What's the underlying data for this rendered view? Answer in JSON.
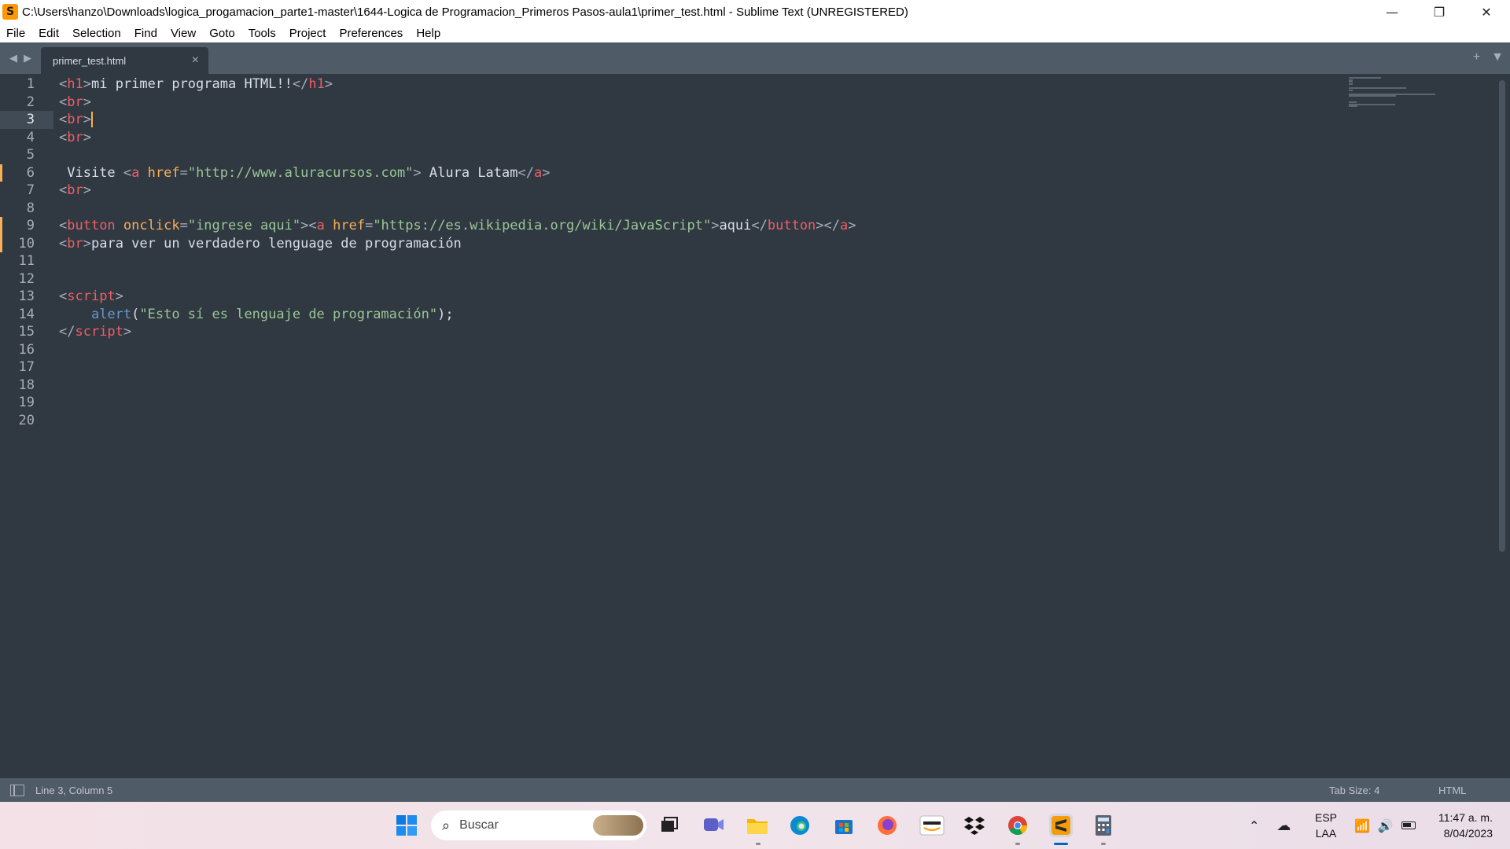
{
  "window": {
    "title": "C:\\Users\\hanzo\\Downloads\\logica_progamacion_parte1-master\\1644-Logica de Programacion_Primeros Pasos-aula1\\primer_test.html - Sublime Text (UNREGISTERED)",
    "app_icon": "sublime-text-icon",
    "controls": {
      "minimize": "—",
      "restore": "❐",
      "close": "✕"
    }
  },
  "menu": [
    "File",
    "Edit",
    "Selection",
    "Find",
    "View",
    "Goto",
    "Tools",
    "Project",
    "Preferences",
    "Help"
  ],
  "tabs": [
    {
      "label": "primer_test.html",
      "close": "×"
    }
  ],
  "tab_tools": {
    "add": "+",
    "dropdown": "▼"
  },
  "editor": {
    "line_numbers": [
      "1",
      "2",
      "3",
      "4",
      "5",
      "6",
      "7",
      "8",
      "9",
      "10",
      "11",
      "12",
      "13",
      "14",
      "15",
      "16",
      "17",
      "18",
      "19",
      "20"
    ],
    "active_line": 3,
    "modified_lines": [
      6,
      9,
      10
    ],
    "lines": [
      [
        [
          "p",
          "<"
        ],
        [
          "tag",
          "h1"
        ],
        [
          "p",
          ">"
        ],
        [
          "text",
          "mi primer programa HTML!!"
        ],
        [
          "p",
          "</"
        ],
        [
          "tag",
          "h1"
        ],
        [
          "p",
          ">"
        ]
      ],
      [
        [
          "p",
          "<"
        ],
        [
          "tag",
          "br"
        ],
        [
          "p",
          ">"
        ]
      ],
      [
        [
          "p",
          "<"
        ],
        [
          "tag",
          "br"
        ],
        [
          "p",
          ">"
        ],
        [
          "caret",
          ""
        ]
      ],
      [
        [
          "p",
          "<"
        ],
        [
          "tag",
          "br"
        ],
        [
          "p",
          ">"
        ]
      ],
      [],
      [
        [
          "text",
          " Visite "
        ],
        [
          "p",
          "<"
        ],
        [
          "tag",
          "a"
        ],
        [
          "text",
          " "
        ],
        [
          "attr",
          "href"
        ],
        [
          "p",
          "="
        ],
        [
          "str",
          "\"http://www.aluracursos.com\""
        ],
        [
          "p",
          ">"
        ],
        [
          "text",
          " Alura Latam"
        ],
        [
          "p",
          "</"
        ],
        [
          "tag",
          "a"
        ],
        [
          "p",
          ">"
        ]
      ],
      [
        [
          "p",
          "<"
        ],
        [
          "tag",
          "br"
        ],
        [
          "p",
          ">"
        ]
      ],
      [],
      [
        [
          "p",
          "<"
        ],
        [
          "tag",
          "button"
        ],
        [
          "text",
          " "
        ],
        [
          "attr",
          "onclick"
        ],
        [
          "p",
          "="
        ],
        [
          "str",
          "\"ingrese aqui\""
        ],
        [
          "p",
          "><"
        ],
        [
          "tag",
          "a"
        ],
        [
          "text",
          " "
        ],
        [
          "attr",
          "href"
        ],
        [
          "p",
          "="
        ],
        [
          "str",
          "\"https://es.wikipedia.org/wiki/JavaScript\""
        ],
        [
          "p",
          ">"
        ],
        [
          "text",
          "aqui"
        ],
        [
          "p",
          "</"
        ],
        [
          "tag",
          "button"
        ],
        [
          "p",
          "></"
        ],
        [
          "tag",
          "a"
        ],
        [
          "p",
          ">"
        ]
      ],
      [
        [
          "p",
          "<"
        ],
        [
          "tag",
          "br"
        ],
        [
          "p",
          ">"
        ],
        [
          "text",
          "para ver un verdadero lenguage de programación"
        ]
      ],
      [],
      [],
      [
        [
          "p",
          "<"
        ],
        [
          "tag",
          "script"
        ],
        [
          "p",
          ">"
        ]
      ],
      [
        [
          "text",
          "    "
        ],
        [
          "fn",
          "alert"
        ],
        [
          "text",
          "("
        ],
        [
          "str",
          "\"Esto sí es lenguaje de programación\""
        ],
        [
          "text",
          ");"
        ]
      ],
      [
        [
          "p",
          "</"
        ],
        [
          "tag",
          "script"
        ],
        [
          "p",
          ">"
        ]
      ],
      [],
      [],
      [],
      [],
      []
    ]
  },
  "status": {
    "position": "Line 3, Column 5",
    "tab_size": "Tab Size: 4",
    "syntax": "HTML"
  },
  "taskbar": {
    "search_placeholder": "Buscar",
    "language_line1": "ESP",
    "language_line2": "LAA",
    "time": "11:47 a. m.",
    "date": "8/04/2023"
  },
  "colors": {
    "editor_bg": "#303841",
    "tag": "#ec5f66",
    "attr": "#f9ae58",
    "string": "#99c794",
    "function": "#6699cc",
    "punct": "#a7adba"
  }
}
